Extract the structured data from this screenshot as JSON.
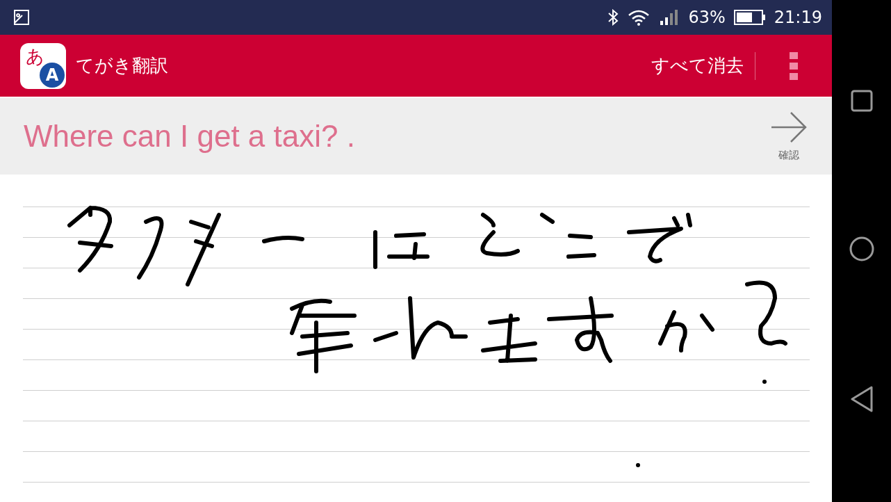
{
  "status_bar": {
    "battery": "63%",
    "time": "21:19"
  },
  "app_bar": {
    "logo_kana": "あ",
    "logo_latin": "A",
    "title": "てがき翻訳",
    "clear_all": "すべて消去"
  },
  "result": {
    "text": "Where can I get a taxi? .",
    "confirm": "確認"
  }
}
